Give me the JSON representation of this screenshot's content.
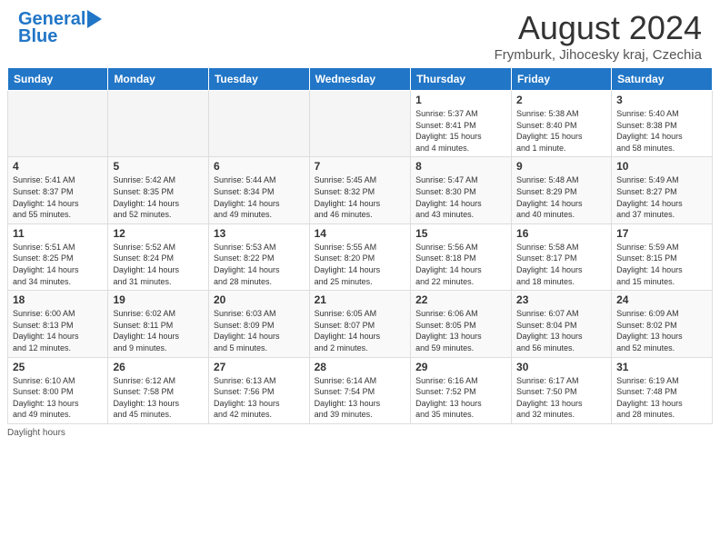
{
  "header": {
    "logo_general": "General",
    "logo_blue": "Blue",
    "month_title": "August 2024",
    "location": "Frymburk, Jihocesky kraj, Czechia"
  },
  "days_of_week": [
    "Sunday",
    "Monday",
    "Tuesday",
    "Wednesday",
    "Thursday",
    "Friday",
    "Saturday"
  ],
  "weeks": [
    {
      "days": [
        {
          "number": "",
          "info": ""
        },
        {
          "number": "",
          "info": ""
        },
        {
          "number": "",
          "info": ""
        },
        {
          "number": "",
          "info": ""
        },
        {
          "number": "1",
          "info": "Sunrise: 5:37 AM\nSunset: 8:41 PM\nDaylight: 15 hours\nand 4 minutes."
        },
        {
          "number": "2",
          "info": "Sunrise: 5:38 AM\nSunset: 8:40 PM\nDaylight: 15 hours\nand 1 minute."
        },
        {
          "number": "3",
          "info": "Sunrise: 5:40 AM\nSunset: 8:38 PM\nDaylight: 14 hours\nand 58 minutes."
        }
      ]
    },
    {
      "days": [
        {
          "number": "4",
          "info": "Sunrise: 5:41 AM\nSunset: 8:37 PM\nDaylight: 14 hours\nand 55 minutes."
        },
        {
          "number": "5",
          "info": "Sunrise: 5:42 AM\nSunset: 8:35 PM\nDaylight: 14 hours\nand 52 minutes."
        },
        {
          "number": "6",
          "info": "Sunrise: 5:44 AM\nSunset: 8:34 PM\nDaylight: 14 hours\nand 49 minutes."
        },
        {
          "number": "7",
          "info": "Sunrise: 5:45 AM\nSunset: 8:32 PM\nDaylight: 14 hours\nand 46 minutes."
        },
        {
          "number": "8",
          "info": "Sunrise: 5:47 AM\nSunset: 8:30 PM\nDaylight: 14 hours\nand 43 minutes."
        },
        {
          "number": "9",
          "info": "Sunrise: 5:48 AM\nSunset: 8:29 PM\nDaylight: 14 hours\nand 40 minutes."
        },
        {
          "number": "10",
          "info": "Sunrise: 5:49 AM\nSunset: 8:27 PM\nDaylight: 14 hours\nand 37 minutes."
        }
      ]
    },
    {
      "days": [
        {
          "number": "11",
          "info": "Sunrise: 5:51 AM\nSunset: 8:25 PM\nDaylight: 14 hours\nand 34 minutes."
        },
        {
          "number": "12",
          "info": "Sunrise: 5:52 AM\nSunset: 8:24 PM\nDaylight: 14 hours\nand 31 minutes."
        },
        {
          "number": "13",
          "info": "Sunrise: 5:53 AM\nSunset: 8:22 PM\nDaylight: 14 hours\nand 28 minutes."
        },
        {
          "number": "14",
          "info": "Sunrise: 5:55 AM\nSunset: 8:20 PM\nDaylight: 14 hours\nand 25 minutes."
        },
        {
          "number": "15",
          "info": "Sunrise: 5:56 AM\nSunset: 8:18 PM\nDaylight: 14 hours\nand 22 minutes."
        },
        {
          "number": "16",
          "info": "Sunrise: 5:58 AM\nSunset: 8:17 PM\nDaylight: 14 hours\nand 18 minutes."
        },
        {
          "number": "17",
          "info": "Sunrise: 5:59 AM\nSunset: 8:15 PM\nDaylight: 14 hours\nand 15 minutes."
        }
      ]
    },
    {
      "days": [
        {
          "number": "18",
          "info": "Sunrise: 6:00 AM\nSunset: 8:13 PM\nDaylight: 14 hours\nand 12 minutes."
        },
        {
          "number": "19",
          "info": "Sunrise: 6:02 AM\nSunset: 8:11 PM\nDaylight: 14 hours\nand 9 minutes."
        },
        {
          "number": "20",
          "info": "Sunrise: 6:03 AM\nSunset: 8:09 PM\nDaylight: 14 hours\nand 5 minutes."
        },
        {
          "number": "21",
          "info": "Sunrise: 6:05 AM\nSunset: 8:07 PM\nDaylight: 14 hours\nand 2 minutes."
        },
        {
          "number": "22",
          "info": "Sunrise: 6:06 AM\nSunset: 8:05 PM\nDaylight: 13 hours\nand 59 minutes."
        },
        {
          "number": "23",
          "info": "Sunrise: 6:07 AM\nSunset: 8:04 PM\nDaylight: 13 hours\nand 56 minutes."
        },
        {
          "number": "24",
          "info": "Sunrise: 6:09 AM\nSunset: 8:02 PM\nDaylight: 13 hours\nand 52 minutes."
        }
      ]
    },
    {
      "days": [
        {
          "number": "25",
          "info": "Sunrise: 6:10 AM\nSunset: 8:00 PM\nDaylight: 13 hours\nand 49 minutes."
        },
        {
          "number": "26",
          "info": "Sunrise: 6:12 AM\nSunset: 7:58 PM\nDaylight: 13 hours\nand 45 minutes."
        },
        {
          "number": "27",
          "info": "Sunrise: 6:13 AM\nSunset: 7:56 PM\nDaylight: 13 hours\nand 42 minutes."
        },
        {
          "number": "28",
          "info": "Sunrise: 6:14 AM\nSunset: 7:54 PM\nDaylight: 13 hours\nand 39 minutes."
        },
        {
          "number": "29",
          "info": "Sunrise: 6:16 AM\nSunset: 7:52 PM\nDaylight: 13 hours\nand 35 minutes."
        },
        {
          "number": "30",
          "info": "Sunrise: 6:17 AM\nSunset: 7:50 PM\nDaylight: 13 hours\nand 32 minutes."
        },
        {
          "number": "31",
          "info": "Sunrise: 6:19 AM\nSunset: 7:48 PM\nDaylight: 13 hours\nand 28 minutes."
        }
      ]
    }
  ],
  "footer": {
    "daylight_label": "Daylight hours"
  }
}
